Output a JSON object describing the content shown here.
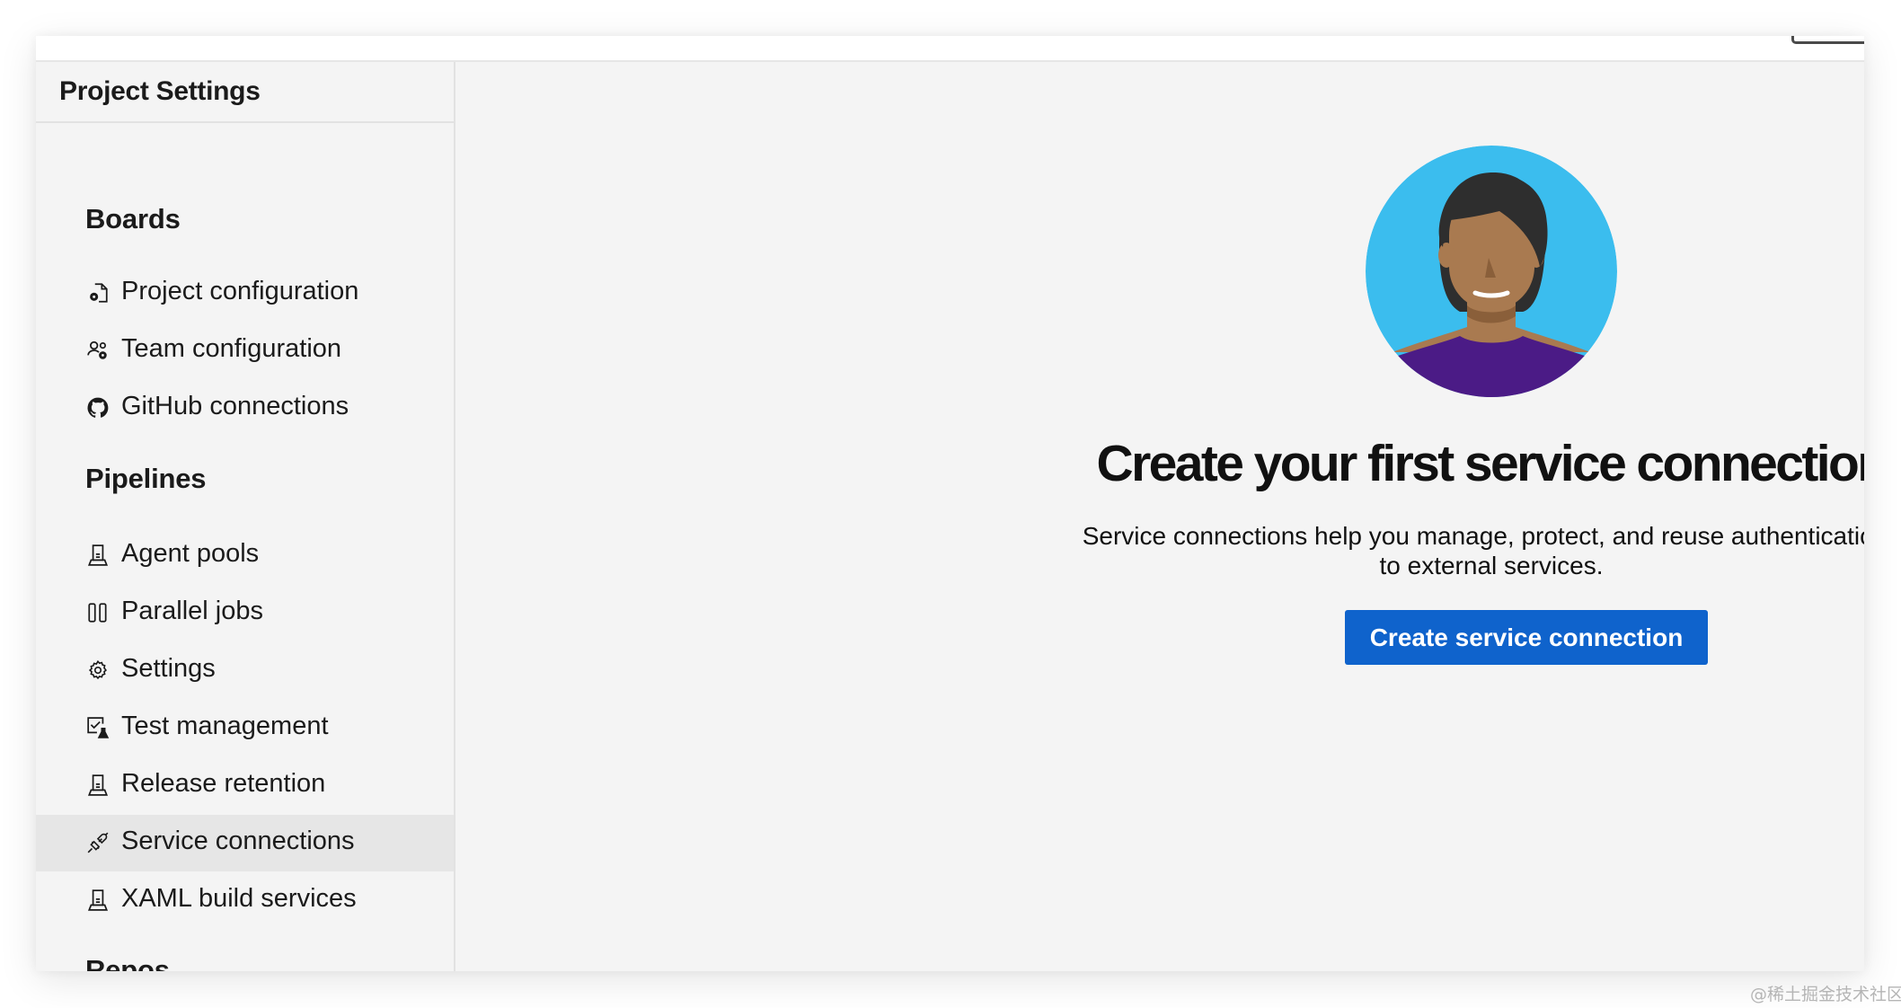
{
  "sidebar": {
    "title": "Project Settings",
    "sections": [
      {
        "label": "Boards",
        "items": [
          {
            "label": "Project configuration",
            "icon": "project-config-icon"
          },
          {
            "label": "Team configuration",
            "icon": "team-config-icon"
          },
          {
            "label": "GitHub connections",
            "icon": "github-icon"
          }
        ]
      },
      {
        "label": "Pipelines",
        "items": [
          {
            "label": "Agent pools",
            "icon": "agent-pool-icon"
          },
          {
            "label": "Parallel jobs",
            "icon": "parallel-jobs-icon"
          },
          {
            "label": "Settings",
            "icon": "gear-icon"
          },
          {
            "label": "Test management",
            "icon": "test-management-icon"
          },
          {
            "label": "Release retention",
            "icon": "agent-pool-icon"
          },
          {
            "label": "Service connections",
            "icon": "plug-icon",
            "selected": true
          },
          {
            "label": "XAML build services",
            "icon": "agent-pool-icon"
          }
        ]
      },
      {
        "label": "Repos",
        "items": []
      }
    ]
  },
  "main": {
    "heading": "Create your first service connection",
    "description_line1": "Service connections help you manage, protect, and reuse authentications",
    "description_line2": "to external services.",
    "cta_label": "Create service connection"
  },
  "colors": {
    "accent": "#0f63cc",
    "avatar_bg": "#3bbdee",
    "avatar_shirt": "#4b1b86",
    "avatar_skin": "#a97a50",
    "avatar_hair": "#2e2e2e",
    "selected_row": "#e6e6e6",
    "panel_bg": "#f4f4f4"
  },
  "watermark": "@稀土掘金技术社区"
}
